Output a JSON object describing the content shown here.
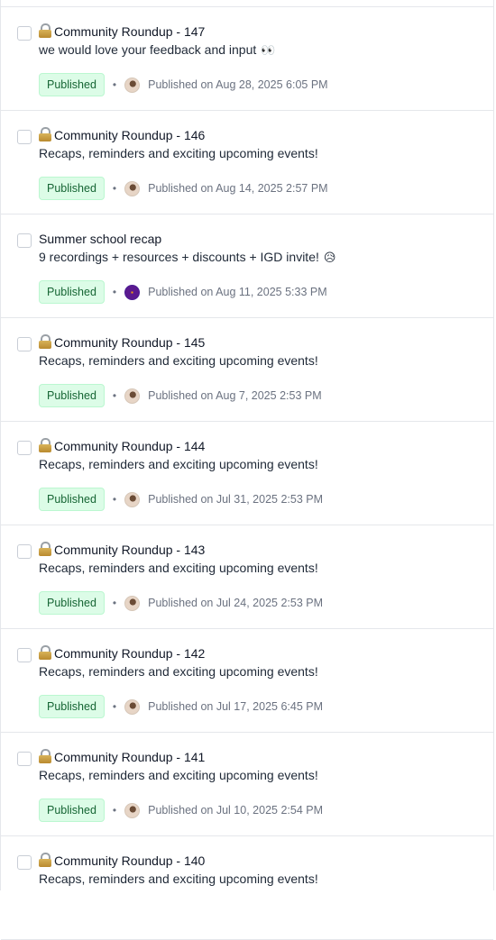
{
  "posts": [
    {
      "title": "Community Roundup - 147",
      "locked": true,
      "subtitle": "we would love your feedback and input",
      "emoji": "👀",
      "status": "Published",
      "avatar": "user-avatar",
      "published": "Published on Aug 28, 2025 6:05 PM"
    },
    {
      "title": "Community Roundup - 146",
      "locked": true,
      "subtitle": "Recaps, reminders and exciting upcoming events!",
      "emoji": "",
      "status": "Published",
      "avatar": "user-avatar",
      "published": "Published on Aug 14, 2025 2:57 PM"
    },
    {
      "title": "Summer school recap",
      "locked": false,
      "subtitle": "9 recordings + resources + discounts + IGD invite!",
      "emoji": "😥",
      "status": "Published",
      "avatar": "brand-avatar",
      "published": "Published on Aug 11, 2025 5:33 PM"
    },
    {
      "title": "Community Roundup - 145",
      "locked": true,
      "subtitle": "Recaps, reminders and exciting upcoming events!",
      "emoji": "",
      "status": "Published",
      "avatar": "user-avatar",
      "published": "Published on Aug 7, 2025 2:53 PM"
    },
    {
      "title": "Community Roundup - 144",
      "locked": true,
      "subtitle": "Recaps, reminders and exciting upcoming events!",
      "emoji": "",
      "status": "Published",
      "avatar": "user-avatar",
      "published": "Published on Jul 31, 2025 2:53 PM"
    },
    {
      "title": "Community Roundup - 143",
      "locked": true,
      "subtitle": "Recaps, reminders and exciting upcoming events!",
      "emoji": "",
      "status": "Published",
      "avatar": "user-avatar",
      "published": "Published on Jul 24, 2025 2:53 PM"
    },
    {
      "title": "Community Roundup - 142",
      "locked": true,
      "subtitle": "Recaps, reminders and exciting upcoming events!",
      "emoji": "",
      "status": "Published",
      "avatar": "user-avatar",
      "published": "Published on Jul 17, 2025 6:45 PM"
    },
    {
      "title": "Community Roundup - 141",
      "locked": true,
      "subtitle": "Recaps, reminders and exciting upcoming events!",
      "emoji": "",
      "status": "Published",
      "avatar": "user-avatar",
      "published": "Published on Jul 10, 2025 2:54 PM"
    },
    {
      "title": "Community Roundup - 140",
      "locked": true,
      "subtitle": "Recaps, reminders and exciting upcoming events!",
      "emoji": "",
      "status": "",
      "avatar": "",
      "published": ""
    }
  ],
  "colors": {
    "badge_bg": "#dcfce7",
    "badge_text": "#166534",
    "divider": "#e5e7eb"
  }
}
